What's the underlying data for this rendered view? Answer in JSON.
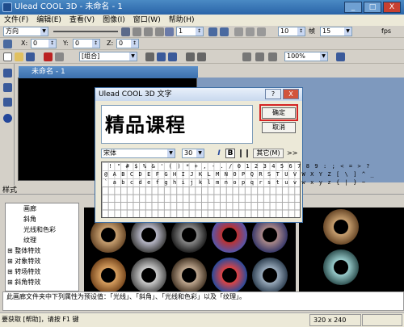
{
  "app": {
    "title": "Ulead COOL 3D - 未命名 - 1"
  },
  "window_controls": {
    "minimize": "_",
    "maximize": "□",
    "close": "X"
  },
  "menu": [
    "文件(F)",
    "编辑(E)",
    "查看(V)",
    "图像(I)",
    "窗口(W)",
    "帮助(H)"
  ],
  "toolbar": {
    "direction_select": "方向",
    "frame_value": "1",
    "frame_rate": "10",
    "frame_unit": "帧",
    "fps_value": "15",
    "fps_unit": "fps",
    "x_label": "X:",
    "x_value": "0",
    "y_label": "Y:",
    "y_value": "0",
    "z_label": "Z:",
    "z_value": "0",
    "group_select": "[组合]",
    "zoom_select": "100%"
  },
  "document": {
    "title": "未命名 - 1"
  },
  "style_label": "样式",
  "tree_items": [
    "画廊",
    "斜角",
    "光线和色彩",
    "纹理",
    "整体特效",
    "对象特效",
    "转场特效",
    "斜角特效"
  ],
  "tree_expand_glyphs": [
    "⊞",
    "⊞",
    "⊞",
    "⊞"
  ],
  "hint_text": "此画廊文件夹中下列属性为预设值：「光线」、「斜角」、「光线和色彩」以及「纹理」。",
  "status": {
    "text": "要获取 [帮助]，请按 F1 键",
    "resolution": "320 x 240"
  },
  "dialog": {
    "title": "Ulead COOL 3D 文字",
    "help_button": "?",
    "close_button": "X",
    "text_value": "精品课程",
    "ok_label": "确定",
    "cancel_label": "取消",
    "font_name": "宋体",
    "font_size": "30",
    "italic_label": "I",
    "bold_label": "B",
    "other_label": "其它(M)",
    "more_label": ">>",
    "char_rows": [
      " ! \" # $ % & ' ( ) * + , - . / 0 1 2 3 4 5 6 7 8 9 : ; < = > ?",
      "@ A B C D E F G H I J K L M N O P Q R S T U V W X Y Z [ \\ ] ^ _",
      "` a b c d e f g h i j k l m n o p q r s t u v w x y z { | } ~"
    ]
  },
  "colors": {
    "accent_frame": "#d42323",
    "titlebar": "#2a64a8",
    "canvas": "#000000"
  }
}
